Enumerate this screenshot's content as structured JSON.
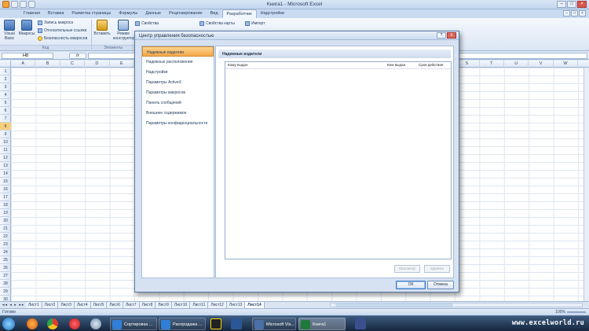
{
  "app": {
    "title": "Книга1 - Microsoft Excel",
    "tabs": [
      "Главная",
      "Вставка",
      "Разметка страницы",
      "Формулы",
      "Данные",
      "Рецензирование",
      "Вид",
      "Разработчик",
      "Надстройки"
    ],
    "active_tab": "Разработчик"
  },
  "ribbon": {
    "visual_basic": "Visual Basic",
    "macros": "Макросы",
    "record_macro": "Запись макроса",
    "relative_refs": "Относительные ссылки",
    "macro_security": "Безопасность макросов",
    "code_group": "Код",
    "insert": "Вставить",
    "design_mode": "Режим конструктора",
    "controls_group": "Элементы",
    "properties": "Свойства",
    "map_properties": "Свойства карты",
    "import": "Импорт"
  },
  "formula_bar": {
    "name_box": "H8",
    "fx": "fx"
  },
  "grid": {
    "columns": [
      "A",
      "B",
      "C",
      "D",
      "E",
      "F",
      "G",
      "H",
      "I",
      "J",
      "K",
      "L",
      "M",
      "N",
      "O",
      "P",
      "Q",
      "R",
      "S",
      "T",
      "U",
      "V",
      "W"
    ],
    "rows": [
      "1",
      "2",
      "3",
      "4",
      "5",
      "6",
      "7",
      "8",
      "9",
      "10",
      "11",
      "12",
      "13",
      "14",
      "15",
      "16",
      "17",
      "18",
      "19",
      "20",
      "21",
      "22",
      "23",
      "24",
      "25",
      "26",
      "27",
      "28",
      "29",
      "30"
    ],
    "selected_row": "8"
  },
  "sheets": {
    "nav": "◂◂ ◂ ▸ ▸▸",
    "tabs": [
      "Лист1",
      "Лист2",
      "Лист3",
      "Лист4",
      "Лист5",
      "Лист6",
      "Лист7",
      "Лист8",
      "Лист9",
      "Лист10",
      "Лист11",
      "Лист12",
      "Лист13",
      "Лист14"
    ],
    "active": "Лист14"
  },
  "status": {
    "ready": "Готово",
    "zoom": "100%"
  },
  "dialog": {
    "title": "Центр управления безопасностью",
    "help": "?",
    "close": "X",
    "nav": [
      "Надежные издатели",
      "Надежные расположения",
      "Надстройки",
      "Параметры ActiveX",
      "Параметры макросов",
      "Панель сообщений",
      "Внешнее содержимое",
      "Параметры конфиденциальности"
    ],
    "active_nav": "Надежные издатели",
    "section_title": "Надежные издатели",
    "columns": [
      "Кому выдан",
      "Кем выдан",
      "Срок действия"
    ],
    "view_button": "Просмотр",
    "remove_button": "Удалить",
    "ok_button": "ОК",
    "cancel_button": "Отмена"
  },
  "taskbar": {
    "items": [
      "Сортировка ...",
      "Распродажа ...",
      "Microsoft Vis...",
      "Книга1"
    ],
    "watermark": "www.excelworld.ru"
  }
}
